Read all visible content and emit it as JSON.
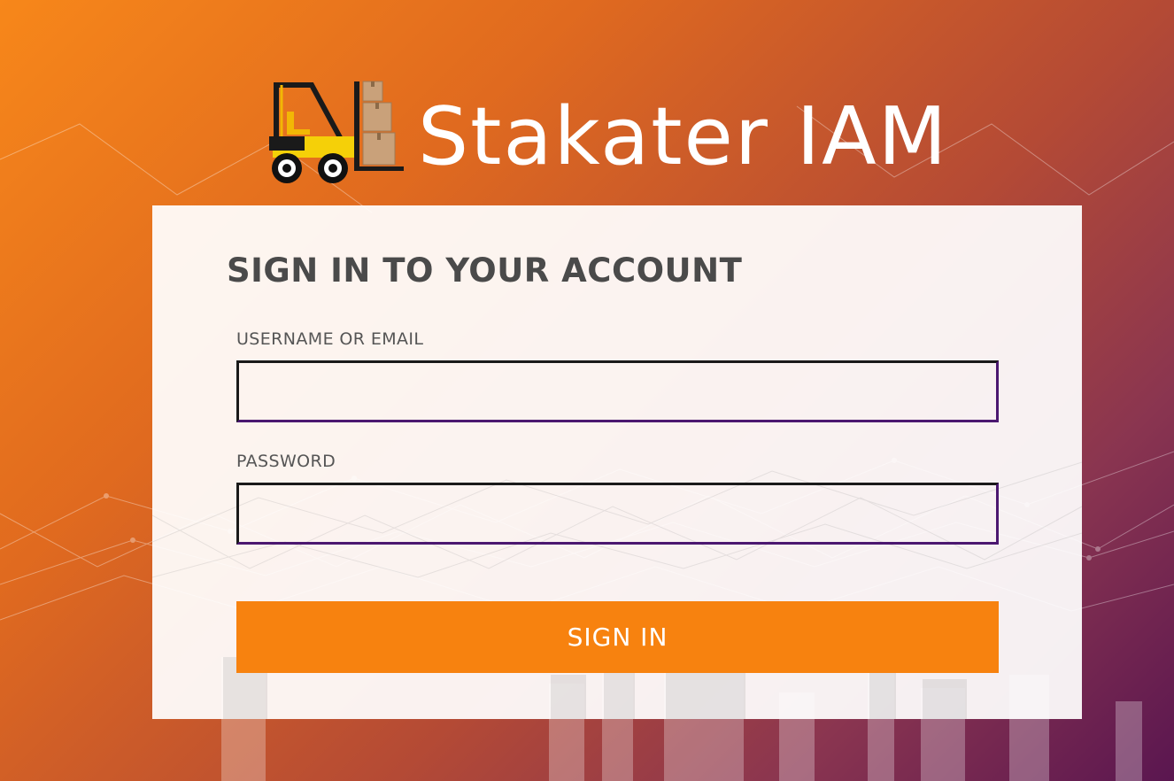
{
  "brand": {
    "title": "Stakater IAM",
    "logo_icon": "forklift-icon"
  },
  "login_form": {
    "heading": "SIGN IN TO YOUR ACCOUNT",
    "username": {
      "label": "USERNAME OR EMAIL",
      "value": "",
      "placeholder": ""
    },
    "password": {
      "label": "PASSWORD",
      "value": "",
      "placeholder": ""
    },
    "submit_label": "SIGN IN"
  },
  "colors": {
    "accent": "#f7820f",
    "background_start": "#f7871a",
    "background_end": "#5a1650",
    "heading_text": "#4a4a4a",
    "input_border_focus": "#4b1870"
  }
}
